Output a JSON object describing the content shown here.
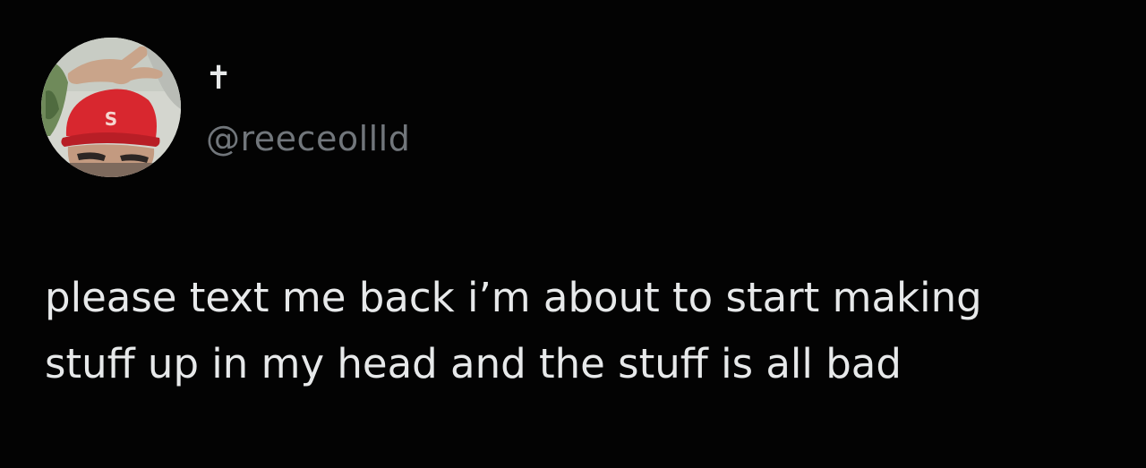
{
  "author": {
    "display_name": "✝",
    "handle": "@reeceollld",
    "avatar_icon": "profile-photo-red-cap"
  },
  "tweet": {
    "text": "please text me back i’m about to start making\nstuff up in my head and the stuff is all bad"
  },
  "colors": {
    "background": "#000000",
    "primary_text": "#e7e9ea",
    "secondary_text": "#71767b",
    "cap_red": "#d8272f"
  }
}
